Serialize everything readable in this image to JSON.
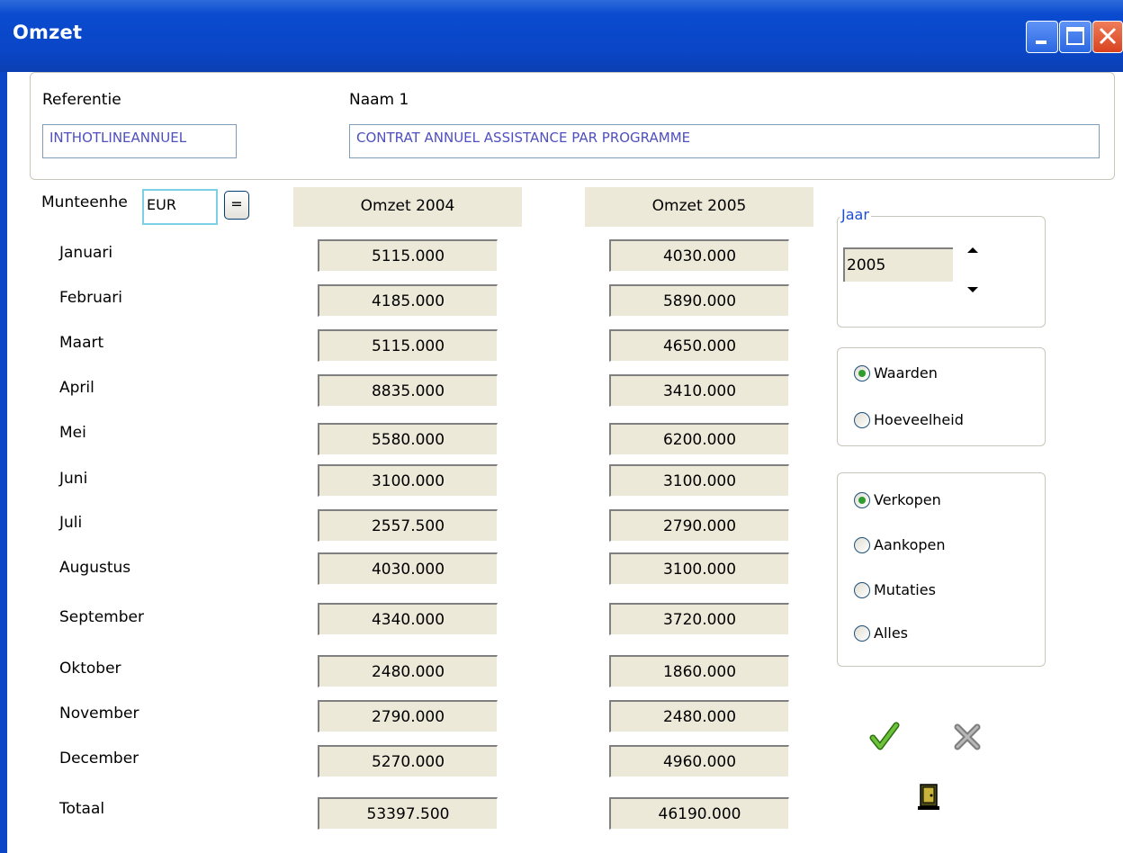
{
  "window": {
    "title": "Omzet"
  },
  "header": {
    "referentie_label": "Referentie",
    "naam_label": "Naam 1",
    "referentie_value": "INTHOTLINEANNUEL",
    "naam_value": "CONTRAT ANNUEL ASSISTANCE PAR PROGRAMME"
  },
  "currency": {
    "label": "Munteenhe",
    "value": "EUR",
    "equals_button": "="
  },
  "columns": {
    "omzet_2004": "Omzet 2004",
    "omzet_2005": "Omzet 2005"
  },
  "rows": [
    {
      "month": "Januari",
      "v2004": "5115.000",
      "v2005": "4030.000"
    },
    {
      "month": "Februari",
      "v2004": "4185.000",
      "v2005": "5890.000"
    },
    {
      "month": "Maart",
      "v2004": "5115.000",
      "v2005": "4650.000"
    },
    {
      "month": "April",
      "v2004": "8835.000",
      "v2005": "3410.000"
    },
    {
      "month": "Mei",
      "v2004": "5580.000",
      "v2005": "6200.000"
    },
    {
      "month": "Juni",
      "v2004": "3100.000",
      "v2005": "3100.000"
    },
    {
      "month": "Juli",
      "v2004": "2557.500",
      "v2005": "2790.000"
    },
    {
      "month": "Augustus",
      "v2004": "4030.000",
      "v2005": "3100.000"
    },
    {
      "month": "September",
      "v2004": "4340.000",
      "v2005": "3720.000"
    },
    {
      "month": "Oktober",
      "v2004": "2480.000",
      "v2005": "1860.000"
    },
    {
      "month": "November",
      "v2004": "2790.000",
      "v2005": "2480.000"
    },
    {
      "month": "December",
      "v2004": "5270.000",
      "v2005": "4960.000"
    }
  ],
  "total": {
    "label": "Totaal",
    "v2004": "53397.500",
    "v2005": "46190.000"
  },
  "year_group": {
    "legend": "Jaar",
    "value": "2005"
  },
  "value_type": {
    "options": [
      "Waarden",
      "Hoeveelheid"
    ],
    "selected": "Waarden"
  },
  "transaction_type": {
    "options": [
      "Verkopen",
      "Aankopen",
      "Mutaties",
      "Alles"
    ],
    "selected": "Verkopen"
  },
  "icons": {
    "ok": "checkmark-icon",
    "cancel": "x-icon",
    "exit": "door-icon"
  },
  "colors": {
    "title_bar": "#0a46c7",
    "readonly_field_bg": "#ece9d8",
    "input_text": "#4f4fbf",
    "jaar_legend": "#1f4fd0",
    "ok_green": "#4fa019"
  }
}
